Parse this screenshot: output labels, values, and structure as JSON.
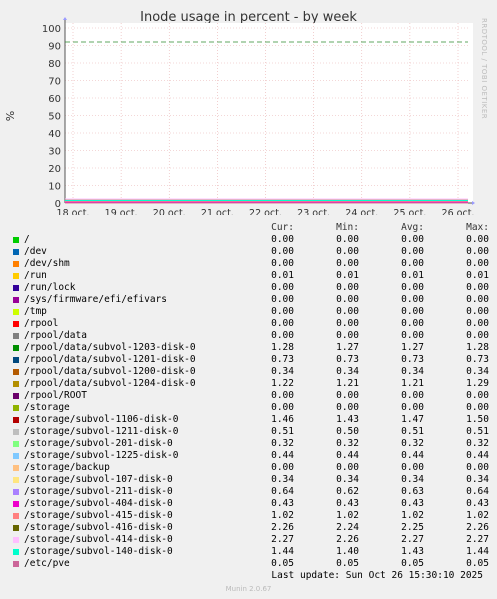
{
  "chart_data": {
    "type": "line",
    "title": "Inode usage in percent - by week",
    "ylabel": "%",
    "ylim": [
      0,
      100
    ],
    "y_ticks": [
      "0",
      "10",
      "20",
      "30",
      "40",
      "50",
      "60",
      "70",
      "80",
      "90",
      "100"
    ],
    "x_ticks": [
      "18 oct.",
      "19 oct.",
      "20 oct.",
      "21 oct.",
      "22 oct.",
      "23 oct.",
      "24 oct.",
      "25 oct.",
      "26 oct."
    ],
    "warning_level": 92,
    "grid": true,
    "columns": [
      "Cur:",
      "Min:",
      "Avg:",
      "Max:"
    ],
    "series": [
      {
        "name": "/",
        "color": "#00cc00",
        "cur": "0.00",
        "min": "0.00",
        "avg": "0.00",
        "max": "0.00"
      },
      {
        "name": "/dev",
        "color": "#0066b3",
        "cur": "0.00",
        "min": "0.00",
        "avg": "0.00",
        "max": "0.00"
      },
      {
        "name": "/dev/shm",
        "color": "#ff8000",
        "cur": "0.00",
        "min": "0.00",
        "avg": "0.00",
        "max": "0.00"
      },
      {
        "name": "/run",
        "color": "#ffcc00",
        "cur": "0.01",
        "min": "0.01",
        "avg": "0.01",
        "max": "0.01"
      },
      {
        "name": "/run/lock",
        "color": "#330099",
        "cur": "0.00",
        "min": "0.00",
        "avg": "0.00",
        "max": "0.00"
      },
      {
        "name": "/sys/firmware/efi/efivars",
        "color": "#990099",
        "cur": "0.00",
        "min": "0.00",
        "avg": "0.00",
        "max": "0.00"
      },
      {
        "name": "/tmp",
        "color": "#ccff00",
        "cur": "0.00",
        "min": "0.00",
        "avg": "0.00",
        "max": "0.00"
      },
      {
        "name": "/rpool",
        "color": "#ff0000",
        "cur": "0.00",
        "min": "0.00",
        "avg": "0.00",
        "max": "0.00"
      },
      {
        "name": "/rpool/data",
        "color": "#808080",
        "cur": "0.00",
        "min": "0.00",
        "avg": "0.00",
        "max": "0.00"
      },
      {
        "name": "/rpool/data/subvol-1203-disk-0",
        "color": "#008f00",
        "cur": "1.28",
        "min": "1.27",
        "avg": "1.27",
        "max": "1.28"
      },
      {
        "name": "/rpool/data/subvol-1201-disk-0",
        "color": "#00487d",
        "cur": "0.73",
        "min": "0.73",
        "avg": "0.73",
        "max": "0.73"
      },
      {
        "name": "/rpool/data/subvol-1200-disk-0",
        "color": "#b35a00",
        "cur": "0.34",
        "min": "0.34",
        "avg": "0.34",
        "max": "0.34"
      },
      {
        "name": "/rpool/data/subvol-1204-disk-0",
        "color": "#b38f00",
        "cur": "1.22",
        "min": "1.21",
        "avg": "1.21",
        "max": "1.29"
      },
      {
        "name": "/rpool/ROOT",
        "color": "#6b006b",
        "cur": "0.00",
        "min": "0.00",
        "avg": "0.00",
        "max": "0.00"
      },
      {
        "name": "/storage",
        "color": "#8fb300",
        "cur": "0.00",
        "min": "0.00",
        "avg": "0.00",
        "max": "0.00"
      },
      {
        "name": "/storage/subvol-1106-disk-0",
        "color": "#b30000",
        "cur": "1.46",
        "min": "1.43",
        "avg": "1.47",
        "max": "1.50"
      },
      {
        "name": "/storage/subvol-1211-disk-0",
        "color": "#bebebe",
        "cur": "0.51",
        "min": "0.50",
        "avg": "0.51",
        "max": "0.51"
      },
      {
        "name": "/storage/subvol-201-disk-0",
        "color": "#80ff80",
        "cur": "0.32",
        "min": "0.32",
        "avg": "0.32",
        "max": "0.32"
      },
      {
        "name": "/storage/subvol-1225-disk-0",
        "color": "#80c9ff",
        "cur": "0.44",
        "min": "0.44",
        "avg": "0.44",
        "max": "0.44"
      },
      {
        "name": "/storage/backup",
        "color": "#ffc080",
        "cur": "0.00",
        "min": "0.00",
        "avg": "0.00",
        "max": "0.00"
      },
      {
        "name": "/storage/subvol-107-disk-0",
        "color": "#ffe680",
        "cur": "0.34",
        "min": "0.34",
        "avg": "0.34",
        "max": "0.34"
      },
      {
        "name": "/storage/subvol-211-disk-0",
        "color": "#aa80ff",
        "cur": "0.64",
        "min": "0.62",
        "avg": "0.63",
        "max": "0.64"
      },
      {
        "name": "/storage/subvol-404-disk-0",
        "color": "#ee00cc",
        "cur": "0.43",
        "min": "0.43",
        "avg": "0.43",
        "max": "0.43"
      },
      {
        "name": "/storage/subvol-415-disk-0",
        "color": "#ff8080",
        "cur": "1.02",
        "min": "1.02",
        "avg": "1.02",
        "max": "1.02"
      },
      {
        "name": "/storage/subvol-416-disk-0",
        "color": "#666600",
        "cur": "2.26",
        "min": "2.24",
        "avg": "2.25",
        "max": "2.26"
      },
      {
        "name": "/storage/subvol-414-disk-0",
        "color": "#ffbfff",
        "cur": "2.27",
        "min": "2.26",
        "avg": "2.27",
        "max": "2.27"
      },
      {
        "name": "/storage/subvol-140-disk-0",
        "color": "#00ffcc",
        "cur": "1.44",
        "min": "1.40",
        "avg": "1.43",
        "max": "1.44"
      },
      {
        "name": "/etc/pve",
        "color": "#cc6699",
        "cur": "0.05",
        "min": "0.05",
        "avg": "0.05",
        "max": "0.05"
      }
    ]
  },
  "side_label": "RRDTOOL / TOBI OETIKER",
  "last_update": "Last update: Sun Oct 26 15:30:10 2025",
  "footer": "Munin 2.0.67"
}
